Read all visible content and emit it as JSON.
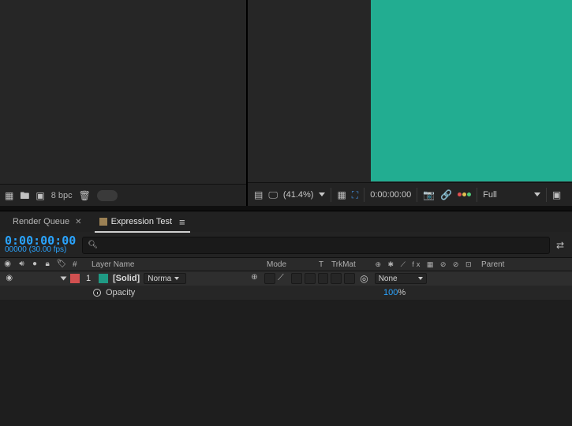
{
  "project_footer": {
    "bpc_label": "8 bpc"
  },
  "viewer_ribbon": {
    "zoom": "(41.4%)",
    "timecode": "0:00:00:00",
    "resolution": "Full"
  },
  "preview": {
    "solid_color": "#22ad91"
  },
  "timeline": {
    "tabs": {
      "render_queue": "Render Queue",
      "active_name": "Expression Test"
    },
    "current_time": "0:00:00:00",
    "frame_info": "00000 (30.00 fps)",
    "columns": {
      "layer_name": "Layer Name",
      "mode": "Mode",
      "t": "T",
      "trkmat": "TrkMat",
      "parent": "Parent",
      "index": "#"
    },
    "switches_header": "⊕ ✱ ⟋ fx ▦ ⊘ ⊘ ⊡",
    "layer": {
      "index": "1",
      "label_color": "#d15050",
      "swatch_color": "#1f9a84",
      "name": "[Solid]",
      "mode": "Norma",
      "parent_value": "None"
    },
    "opacity": {
      "label": "Opacity",
      "value": "100",
      "pct": "%"
    }
  }
}
